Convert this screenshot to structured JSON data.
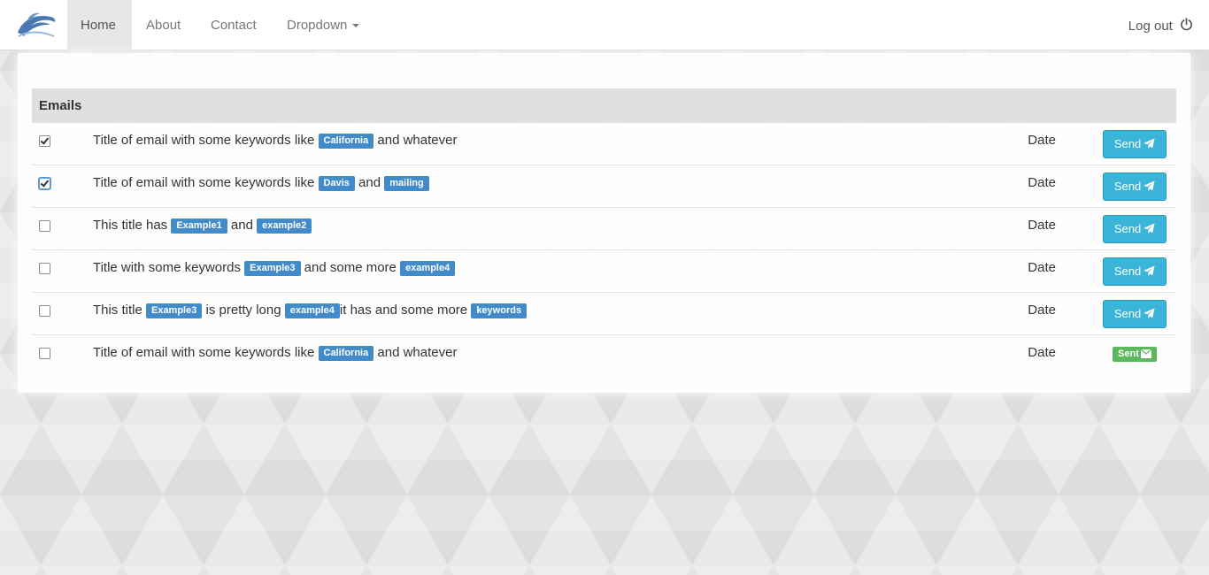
{
  "nav": {
    "items": [
      {
        "label": "Home",
        "active": true
      },
      {
        "label": "About"
      },
      {
        "label": "Contact"
      },
      {
        "label": "Dropdown"
      }
    ],
    "logout_label": "Log out",
    "brand_icon": "dolphin-logo",
    "logout_icon": "power-icon"
  },
  "table": {
    "header": "Emails",
    "send_label": "Send",
    "sent_label": "Sent",
    "rows": [
      {
        "checked": true,
        "parts": [
          "Title of email with some keywords like ",
          "California",
          " and whatever"
        ],
        "date": "Date",
        "status": "send"
      },
      {
        "checked": true,
        "parts": [
          "Title of email with some keywords like ",
          "Davis",
          " and ",
          "mailing",
          ""
        ],
        "date": "Date",
        "status": "send"
      },
      {
        "checked": false,
        "parts": [
          "This title has ",
          "Example1",
          " and ",
          "example2",
          ""
        ],
        "date": "Date",
        "status": "send"
      },
      {
        "checked": false,
        "parts": [
          "Title with some keywords ",
          "Example3",
          " and some more ",
          "example4",
          ""
        ],
        "date": "Date",
        "status": "send"
      },
      {
        "checked": false,
        "parts": [
          "This title ",
          "Example3",
          " is pretty long ",
          "example4",
          "it has and some more ",
          "keywords",
          ""
        ],
        "date": "Date",
        "status": "send"
      },
      {
        "checked": false,
        "parts": [
          "Title of email with some keywords like ",
          "California",
          " and whatever"
        ],
        "date": "Date",
        "status": "sent"
      }
    ]
  },
  "colors": {
    "label_blue": "#428bca",
    "send_button": "#3ab4d8",
    "sent_green": "#5cb85c"
  }
}
